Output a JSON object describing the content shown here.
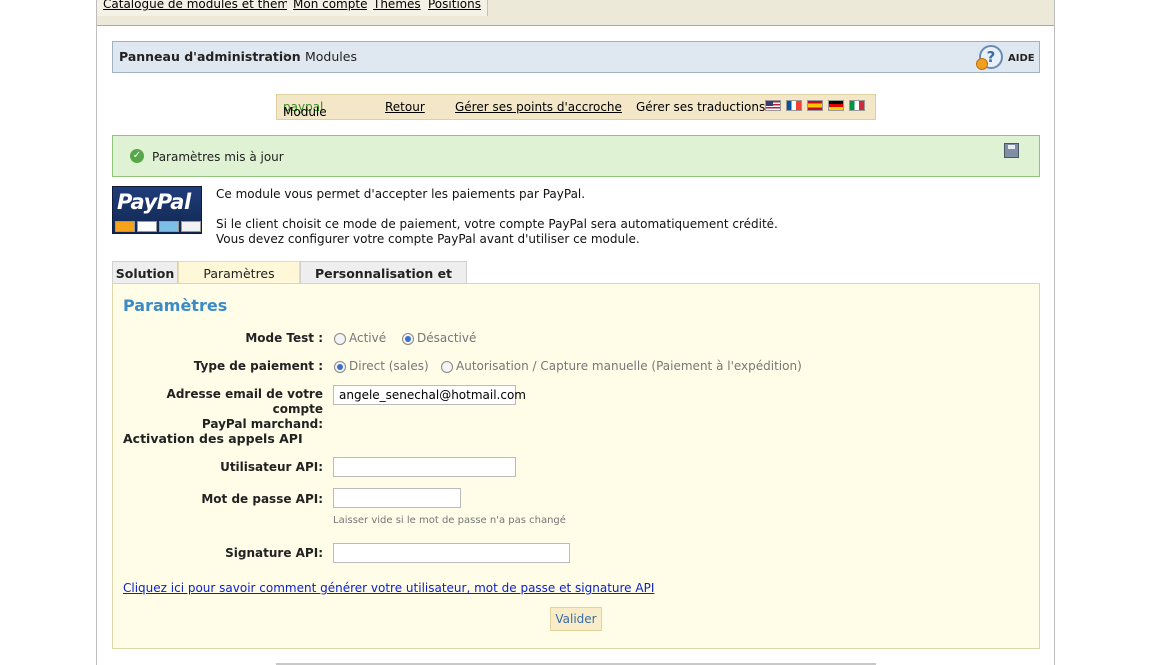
{
  "topnav": {
    "items": [
      {
        "label": "Catalogue de modules et thèmes"
      },
      {
        "label": "Mon compte"
      },
      {
        "label": "Thèmes"
      },
      {
        "label": "Positions"
      }
    ]
  },
  "breadcrumb": {
    "root": "Panneau d'administration",
    "separator": "›",
    "current": "Modules",
    "help_label": "AIDE"
  },
  "module_bar": {
    "prefix": "Module",
    "module_name": "paypal",
    "back": "Retour",
    "hooks": "Gérer ses points d'accroche",
    "translations": "Gérer ses traductions",
    "flags": [
      "en-flag-icon",
      "fr-flag-icon",
      "es-flag-icon",
      "de-flag-icon",
      "it-flag-icon"
    ]
  },
  "confirmation": {
    "message": "Paramètres mis à jour"
  },
  "intro": {
    "logo_text": "PayPal",
    "line1": "Ce module vous permet d'accepter les paiements par PayPal.",
    "line2": "Si le client choisit ce mode de paiement, votre compte PayPal sera automatiquement crédité.",
    "line3": "Vous devez configurer votre compte PayPal avant d'utiliser ce module."
  },
  "tabs": [
    {
      "label": "Solution",
      "active": false
    },
    {
      "label": "Paramètres",
      "active": true
    },
    {
      "label": "Personnalisation et logos",
      "active": false
    }
  ],
  "form": {
    "title": "Paramètres",
    "mode_test": {
      "label": "Mode Test :",
      "options": [
        "Activé",
        "Désactivé"
      ],
      "selected": "Désactivé"
    },
    "payment_type": {
      "label": "Type de paiement :",
      "options": [
        "Direct (sales)",
        "Autorisation / Capture manuelle (Paiement à l'expédition)"
      ],
      "selected": "Direct (sales)"
    },
    "email": {
      "label_line1": "Adresse email de votre compte",
      "label_line2": "PayPal marchand:",
      "value": "angele_senechal@hotmail.com"
    },
    "api_section": "Activation des appels API",
    "api_user": {
      "label": "Utilisateur API:",
      "value": ""
    },
    "api_password": {
      "label": "Mot de passe API:",
      "value": "",
      "hint": "Laisser vide si le mot de passe n'a pas changé"
    },
    "api_signature": {
      "label": "Signature API:",
      "value": ""
    },
    "help_link": "Cliquez ici pour savoir comment générer votre utilisateur, mot de passe et signature API",
    "submit": "Valider"
  },
  "colors": {
    "breadcrumb_bg": "#dfe8f0",
    "confirm_bg": "#dff2d3",
    "panel_bg": "#fffce8",
    "title_blue": "#3b8cc6",
    "link_blue": "#0b22c8"
  }
}
